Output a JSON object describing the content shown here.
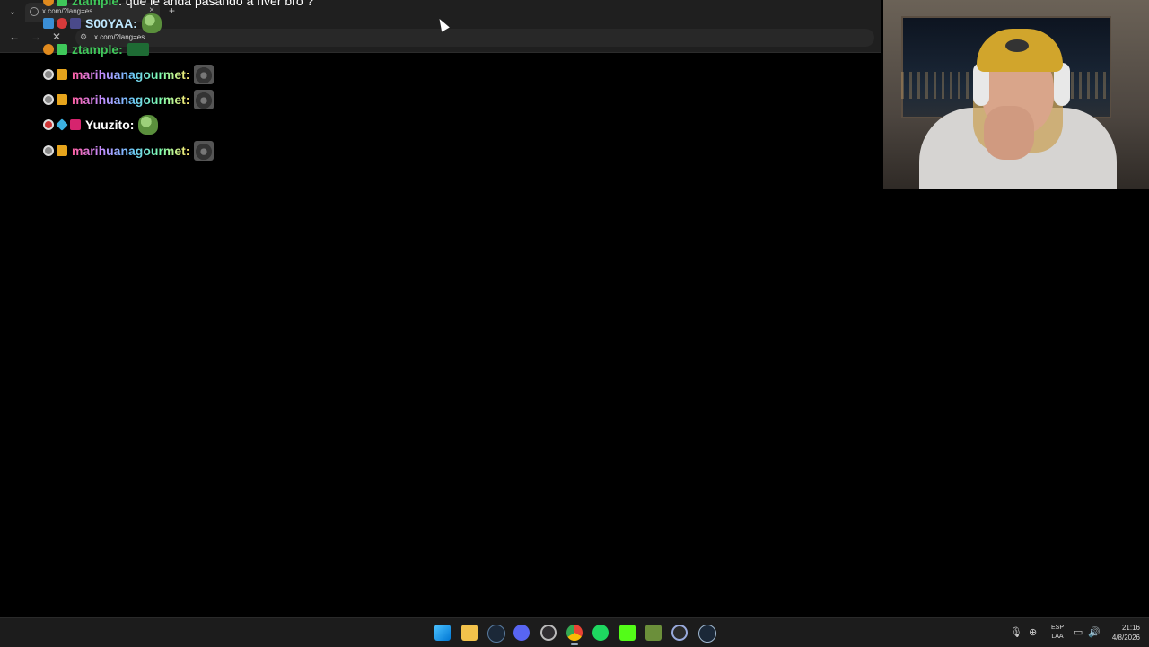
{
  "browser": {
    "tab_title": "x.com/?lang=es",
    "tab_close": "×",
    "new_tab": "+",
    "url": "x.com/?lang=es",
    "back": "←",
    "forward": "→",
    "reload": "✕",
    "tab_list": "⌄",
    "site_info": "⚙"
  },
  "chat": {
    "lines": [
      {
        "username": "ztample",
        "color": "#3fc85a",
        "text": ": que le anda pasando a river bro ?"
      },
      {
        "username": "S00YAA:",
        "color": "#bfe8ff",
        "text": ""
      },
      {
        "username": "ztample:",
        "color": "#3fc85a",
        "text": ""
      },
      {
        "username": "marihuanagourmet:",
        "color": "rainbow",
        "text": ""
      },
      {
        "username": "marihuanagourmet:",
        "color": "rainbow",
        "text": ""
      },
      {
        "username": "Yuuzito:",
        "color": "#ffffff",
        "text": ""
      },
      {
        "username": "marihuanagourmet:",
        "color": "rainbow",
        "text": ""
      }
    ]
  },
  "taskbar": {
    "icons": [
      "windows-start-icon",
      "file-explorer-icon",
      "steam-icon",
      "discord-icon",
      "obs-icon",
      "chrome-icon",
      "spotify-icon",
      "kick-icon",
      "minecraft-icon",
      "ccleaner-icon",
      "steam-alt-icon"
    ],
    "tray": {
      "mic": "🎙",
      "network": "⊕",
      "language_line1": "ESP",
      "language_line2": "LAA",
      "display": "▭",
      "volume": "🔊",
      "time": "21:16",
      "date": "4/8/2026"
    }
  }
}
